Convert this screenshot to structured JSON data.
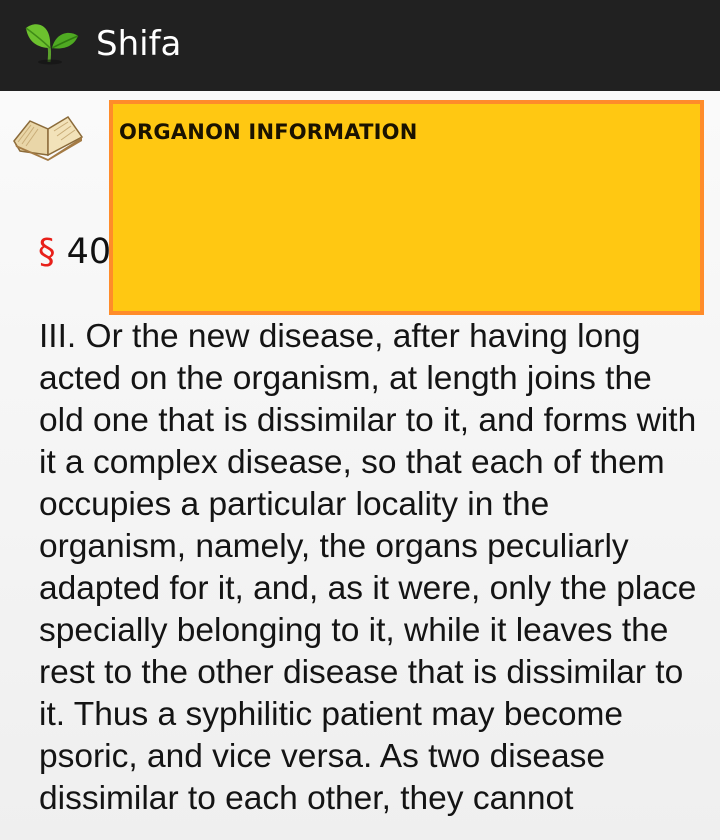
{
  "app": {
    "title": "Shifa",
    "icon": "leaf-icon"
  },
  "colors": {
    "action_bar": "#212121",
    "info_box_fill": "#ffc812",
    "info_box_border": "#ff8c2a",
    "section_sign": "#e8201a"
  },
  "content": {
    "book_icon": "open-book-icon",
    "section_symbol": "§",
    "section_number": "40",
    "info_box_title": "ORGANON INFORMATION",
    "paragraph": "III. Or the new disease, after having long acted on the organism, at length joins the old one that is dissimilar to it, and forms with it a complex disease, so that each of them occupies a particular locality in the organism, namely, the organs peculiarly adapted for it, and, as it were, only the place specially belonging to it, while it leaves the rest to the other disease that is dissimilar to it. Thus a syphilitic patient may become psoric, and vice versa. As two disease dissimilar to each other, they cannot"
  }
}
